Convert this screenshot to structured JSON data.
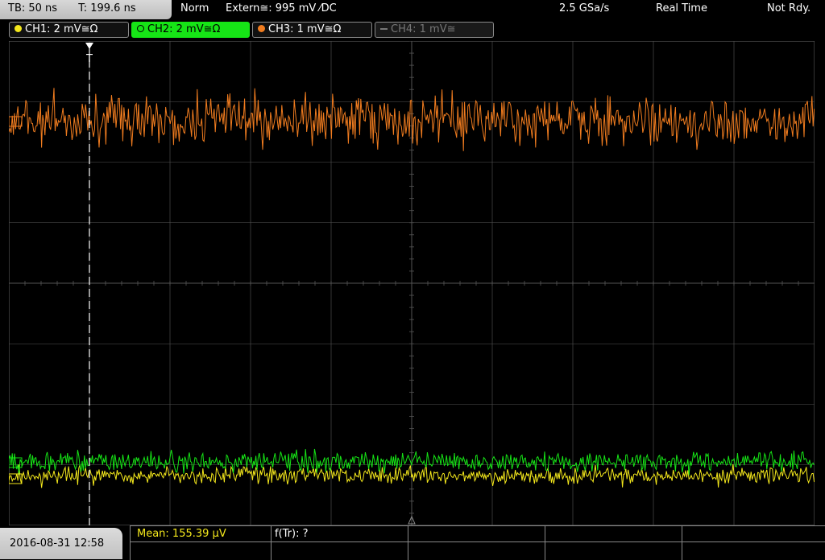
{
  "status": {
    "timebase": "TB: 50 ns",
    "trigger_time": "T: 199.6 ns",
    "mode": "Norm",
    "trigger": "Extern≅: 995 mV ⁄DC",
    "sample_rate": "2.5 GSa/s",
    "acq_mode": "Real Time",
    "state": "Not Rdy."
  },
  "channels": [
    {
      "label": "CH1: 2 mV≅Ω",
      "color": "#f4e81c",
      "active": true
    },
    {
      "label": "CH2: 2 mV≅Ω",
      "color": "#16e516",
      "active": true,
      "selected": true
    },
    {
      "label": "CH3: 1 mV≅Ω",
      "color": "#f07c1f",
      "active": true
    },
    {
      "label": "CH4: 1 mV≅",
      "color": "#8a8a8a",
      "active": false
    }
  ],
  "trigger_marker": "T",
  "datetime": "2016-08-31 12:58",
  "measurements": {
    "mean": "Mean: 155.39 µV",
    "freq": "f(Tr): ?"
  },
  "colors": {
    "grid": "#555555",
    "ch1": "#f4e81c",
    "ch2": "#16e516",
    "ch3": "#f07c1f"
  }
}
